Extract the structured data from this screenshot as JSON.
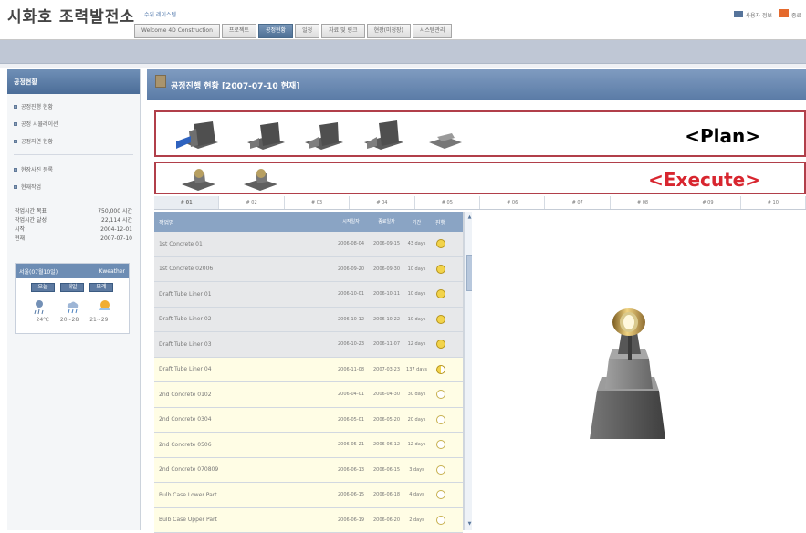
{
  "header": {
    "brand": "시화호 조력발전소",
    "subtitle": "수위 레이스템",
    "right_link_1": "사용자 정보",
    "right_link_2": "종료"
  },
  "nav": [
    "Welcome 4D Construction",
    "프로젝트",
    "공정현황",
    "일정",
    "자료 및 링크",
    "현장(미정장)",
    "시스템관리"
  ],
  "sidebar": {
    "title": "공정현황",
    "items": [
      "공정진행 현황",
      "공정 시뮬레이션",
      "공정지연 현황",
      "현장사진 등록",
      "현재작업"
    ],
    "stats": [
      {
        "label": "작업시간 목표",
        "value": "750,000 시간"
      },
      {
        "label": "작업시간 달성",
        "value": "22,114 시간"
      },
      {
        "label": "시작",
        "value": "2004-12-01"
      },
      {
        "label": "현재",
        "value": "2007-07-10"
      }
    ],
    "weather": {
      "title": "서울(07월10일)",
      "brand": "Kweather",
      "days": [
        "오늘",
        "내일",
        "모레"
      ],
      "temps": [
        "24℃",
        "20~28",
        "21~29"
      ]
    }
  },
  "main": {
    "title": "공정진행 현황 [2007-07-10 현재]",
    "plan_label": "<Plan>",
    "execute_label": "<Execute>",
    "tabs": [
      "# 01",
      "# 02",
      "# 03",
      "# 04",
      "# 05",
      "# 06",
      "# 07",
      "# 08",
      "# 09",
      "# 10"
    ],
    "columns": [
      "작업명",
      "시작일자",
      "종료일자",
      "기간",
      "진행"
    ],
    "rows": [
      {
        "name": "1st Concrete 01",
        "start": "2006-08-04",
        "end": "2006-09-15",
        "duration": "43 days",
        "status": "full",
        "band": "gray"
      },
      {
        "name": "1st Concrete 02006",
        "start": "2006-09-20",
        "end": "2006-09-30",
        "duration": "10 days",
        "status": "full",
        "band": "gray"
      },
      {
        "name": "Draft Tube Liner 01",
        "start": "2006-10-01",
        "end": "2006-10-11",
        "duration": "10 days",
        "status": "full",
        "band": "gray"
      },
      {
        "name": "Draft Tube Liner 02",
        "start": "2006-10-12",
        "end": "2006-10-22",
        "duration": "10 days",
        "status": "full",
        "band": "gray"
      },
      {
        "name": "Draft Tube Liner 03",
        "start": "2006-10-23",
        "end": "2006-11-07",
        "duration": "12 days",
        "status": "full",
        "band": "gray"
      },
      {
        "name": "Draft Tube Liner 04",
        "start": "2006-11-08",
        "end": "2007-03-23",
        "duration": "137 days",
        "status": "half",
        "band": "yellow"
      },
      {
        "name": "2nd Concrete 0102",
        "start": "2006-04-01",
        "end": "2006-04-30",
        "duration": "30 days",
        "status": "empty",
        "band": "yellow"
      },
      {
        "name": "2nd Concrete 0304",
        "start": "2006-05-01",
        "end": "2006-05-20",
        "duration": "20 days",
        "status": "empty",
        "band": "yellow"
      },
      {
        "name": "2nd Concrete 0506",
        "start": "2006-05-21",
        "end": "2006-06-12",
        "duration": "12 days",
        "status": "empty",
        "band": "yellow"
      },
      {
        "name": "2nd Concrete 070809",
        "start": "2006-06-13",
        "end": "2006-06-15",
        "duration": "3 days",
        "status": "empty",
        "band": "yellow"
      },
      {
        "name": "Bulb Case Lower Part",
        "start": "2006-06-15",
        "end": "2006-06-18",
        "duration": "4 days",
        "status": "empty",
        "band": "yellow"
      },
      {
        "name": "Bulb Case Upper Part",
        "start": "2006-06-19",
        "end": "2006-06-20",
        "duration": "2 days",
        "status": "empty",
        "band": "yellow"
      }
    ]
  }
}
